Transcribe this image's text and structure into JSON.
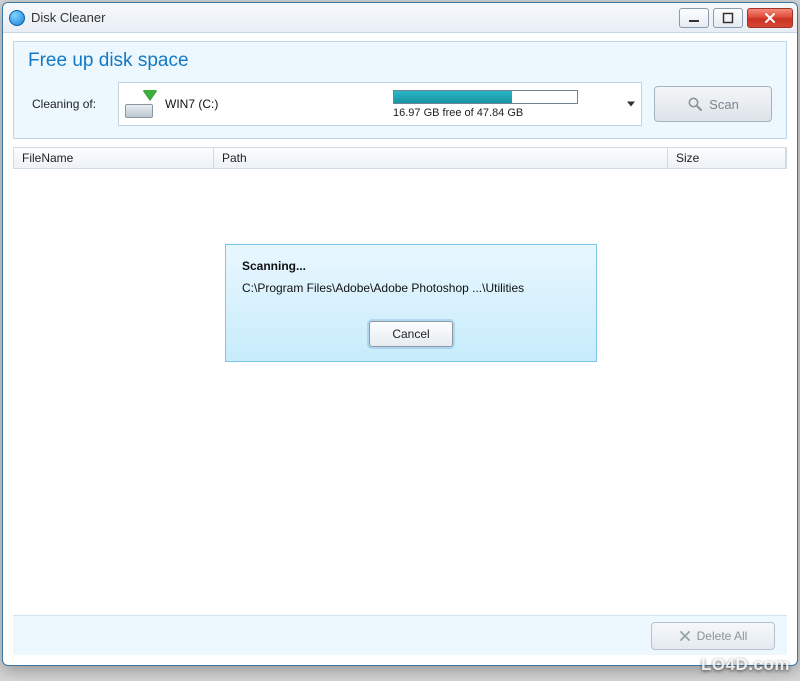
{
  "window": {
    "title": "Disk Cleaner"
  },
  "header": {
    "title": "Free up disk space",
    "cleaning_label": "Cleaning of:",
    "drive_name": "WIN7 (C:)",
    "usage_text": "16.97 GB free of 47.84 GB",
    "scan_label": "Scan"
  },
  "columns": {
    "filename": "FileName",
    "path": "Path",
    "size": "Size"
  },
  "dialog": {
    "title": "Scanning...",
    "path": "C:\\Program Files\\Adobe\\Adobe Photoshop ...\\Utilities",
    "cancel": "Cancel"
  },
  "footer": {
    "delete_all": "Delete All"
  },
  "watermark": "LO4D.com"
}
